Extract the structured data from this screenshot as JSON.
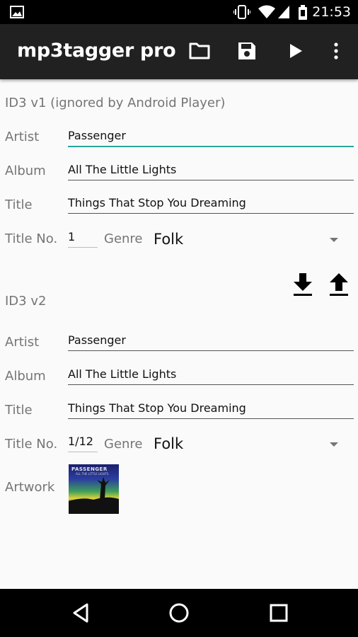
{
  "status_bar": {
    "time": "21:53"
  },
  "app_bar": {
    "title": "mp3tagger pro",
    "actions": [
      "folder-icon",
      "save-icon",
      "play-icon",
      "overflow-menu-icon"
    ]
  },
  "id3v1": {
    "section_title": "ID3 v1 (ignored by Android Player)",
    "artist_label": "Artist",
    "artist": "Passenger",
    "album_label": "Album",
    "album": "All The Little Lights",
    "title_label": "Title",
    "title": "Things That Stop You Dreaming",
    "track_label": "Title No.",
    "track": "1",
    "genre_label": "Genre",
    "genre": "Folk"
  },
  "id3v2": {
    "section_title": "ID3 v2",
    "artist_label": "Artist",
    "artist": "Passenger",
    "album_label": "Album",
    "album": "All The Little Lights",
    "title_label": "Title",
    "title": "Things That Stop You Dreaming",
    "track_label": "Title No.",
    "track": "1/12",
    "genre_label": "Genre",
    "genre": "Folk",
    "artwork_label": "Artwork",
    "artwork_text": "PASSENGER",
    "artwork_subtext": "ALL THE LITTLE LIGHTS"
  },
  "colors": {
    "accent": "#26a69a",
    "app_bar": "#212121",
    "background": "#fafafa"
  }
}
